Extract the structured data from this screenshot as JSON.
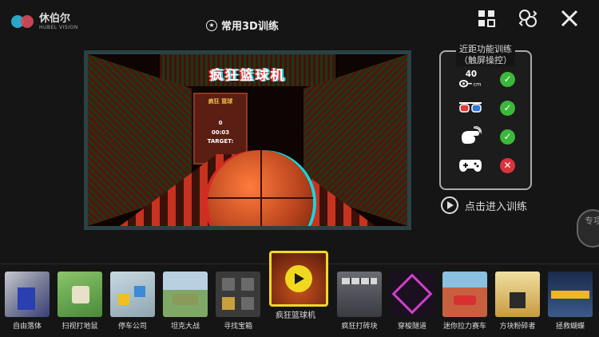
{
  "brand": {
    "name_cn": "休伯尔",
    "name_en": "HUBEL VISION"
  },
  "page_title": "常用3D训练",
  "top_icons": [
    "grid-icon",
    "switch-user-icon",
    "close-icon"
  ],
  "preview": {
    "game_title": "疯狂篮球机",
    "backboard_title": "疯狂\n篮球",
    "score": "0",
    "timer": "00:03",
    "target_label": "TARGET:"
  },
  "mode_panel": {
    "title_line1": "近距功能训练",
    "title_line2": "（触屏操控）",
    "rows": [
      {
        "icon": "distance-40cm-icon",
        "icon_text": "40",
        "icon_unit": "cm",
        "supported": true
      },
      {
        "icon": "3d-glasses-icon",
        "supported": true
      },
      {
        "icon": "touch-icon",
        "supported": true
      },
      {
        "icon": "gamepad-icon",
        "supported": false
      }
    ]
  },
  "enter_training_label": "点击进入训练",
  "side_tab_label": "专项",
  "games": [
    {
      "label": "自由落体",
      "color": "#8a8fa6"
    },
    {
      "label": "扫视打地鼠",
      "color": "#5a8f46"
    },
    {
      "label": "停车公司",
      "color": "#8fa6b0"
    },
    {
      "label": "坦克大战",
      "color": "#7fa866"
    },
    {
      "label": "寻找宝箱",
      "color": "#4a4a4a"
    },
    {
      "label": "疯狂篮球机",
      "color": "#7a2010",
      "selected": true
    },
    {
      "label": "疯狂打砖块",
      "color": "#4c4c54"
    },
    {
      "label": "穿梭隧道",
      "color": "#3a2a4a"
    },
    {
      "label": "迷你拉力赛车",
      "color": "#b4503a"
    },
    {
      "label": "方块粉碎者",
      "color": "#d8c46a"
    },
    {
      "label": "拯救蝴蝶",
      "color": "#2a4a6a"
    }
  ],
  "accent_color": "#f1d820",
  "ok_color": "#3bb83a",
  "no_color": "#d9343c"
}
